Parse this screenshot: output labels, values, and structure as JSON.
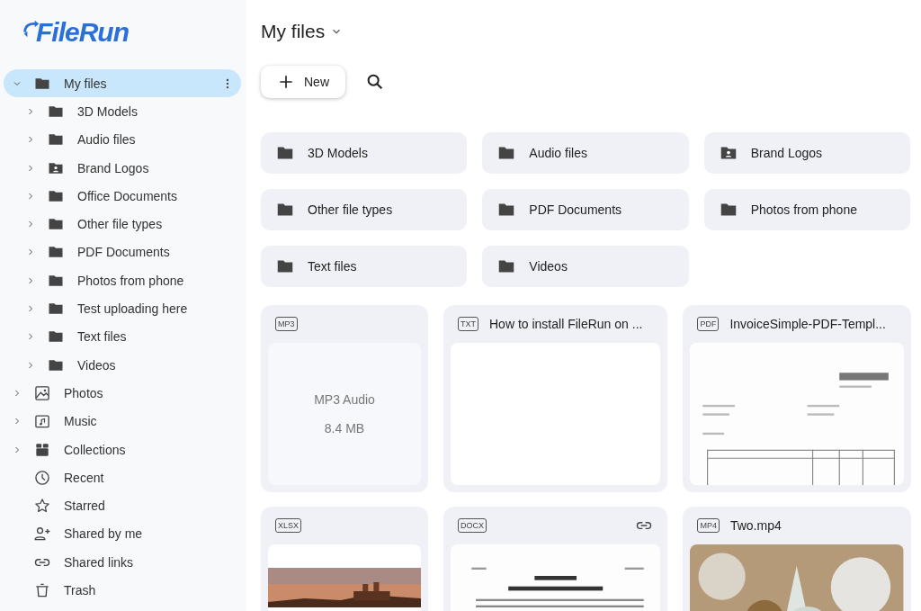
{
  "logo": "FileRun",
  "sidebar": {
    "items": [
      {
        "label": "My files",
        "kind": "folder",
        "expanded": true,
        "selected": true,
        "children": [
          {
            "label": "3D Models",
            "kind": "folder",
            "expanded": false,
            "selected": false
          },
          {
            "label": "Audio files",
            "kind": "folder",
            "expanded": false,
            "selected": false
          },
          {
            "label": "Brand Logos",
            "kind": "shared-folder",
            "expanded": false,
            "selected": false
          },
          {
            "label": "Office Documents",
            "kind": "folder",
            "expanded": false,
            "selected": false
          },
          {
            "label": "Other file types",
            "kind": "folder",
            "expanded": false,
            "selected": false
          },
          {
            "label": "PDF Documents",
            "kind": "folder",
            "expanded": false,
            "selected": false
          },
          {
            "label": "Photos from phone",
            "kind": "folder",
            "expanded": false,
            "selected": false
          },
          {
            "label": "Test uploading here",
            "kind": "folder",
            "expanded": false,
            "selected": false
          },
          {
            "label": "Text files",
            "kind": "folder",
            "expanded": false,
            "selected": false
          },
          {
            "label": "Videos",
            "kind": "folder",
            "expanded": false,
            "selected": false
          }
        ]
      },
      {
        "label": "Photos",
        "kind": "photos",
        "expanded": false,
        "selected": false
      },
      {
        "label": "Music",
        "kind": "music",
        "expanded": false,
        "selected": false
      },
      {
        "label": "Collections",
        "kind": "collections",
        "expanded": false,
        "selected": false
      },
      {
        "label": "Recent",
        "kind": "recent",
        "selected": false
      },
      {
        "label": "Starred",
        "kind": "starred",
        "selected": false
      },
      {
        "label": "Shared by me",
        "kind": "shared",
        "selected": false
      },
      {
        "label": "Shared links",
        "kind": "links",
        "selected": false
      },
      {
        "label": "Trash",
        "kind": "trash",
        "selected": false
      }
    ]
  },
  "header": {
    "title": "My files",
    "new_button": "New"
  },
  "folders": [
    {
      "name": "3D Models",
      "kind": "folder"
    },
    {
      "name": "Audio files",
      "kind": "folder"
    },
    {
      "name": "Brand Logos",
      "kind": "shared-folder"
    },
    {
      "name": "Other file types",
      "kind": "folder"
    },
    {
      "name": "PDF Documents",
      "kind": "folder"
    },
    {
      "name": "Photos from phone",
      "kind": "folder"
    },
    {
      "name": "Text files",
      "kind": "folder"
    },
    {
      "name": "Videos",
      "kind": "folder"
    }
  ],
  "files": [
    {
      "type": "MP3",
      "linked": false,
      "preview": {
        "kind": "info",
        "lines": [
          "MP3 Audio",
          "8.4 MB"
        ]
      }
    },
    {
      "type": "TXT",
      "name": "How to install FileRun on ...",
      "linked": false,
      "preview": {
        "kind": "blank"
      }
    },
    {
      "type": "PDF",
      "name": "InvoiceSimple-PDF-Templ...",
      "linked": false
    },
    {
      "type": "XLSX",
      "linked": false
    },
    {
      "type": "DOCX",
      "linked": true
    },
    {
      "type": "MP4",
      "name": "Two.mp4",
      "linked": false
    }
  ]
}
